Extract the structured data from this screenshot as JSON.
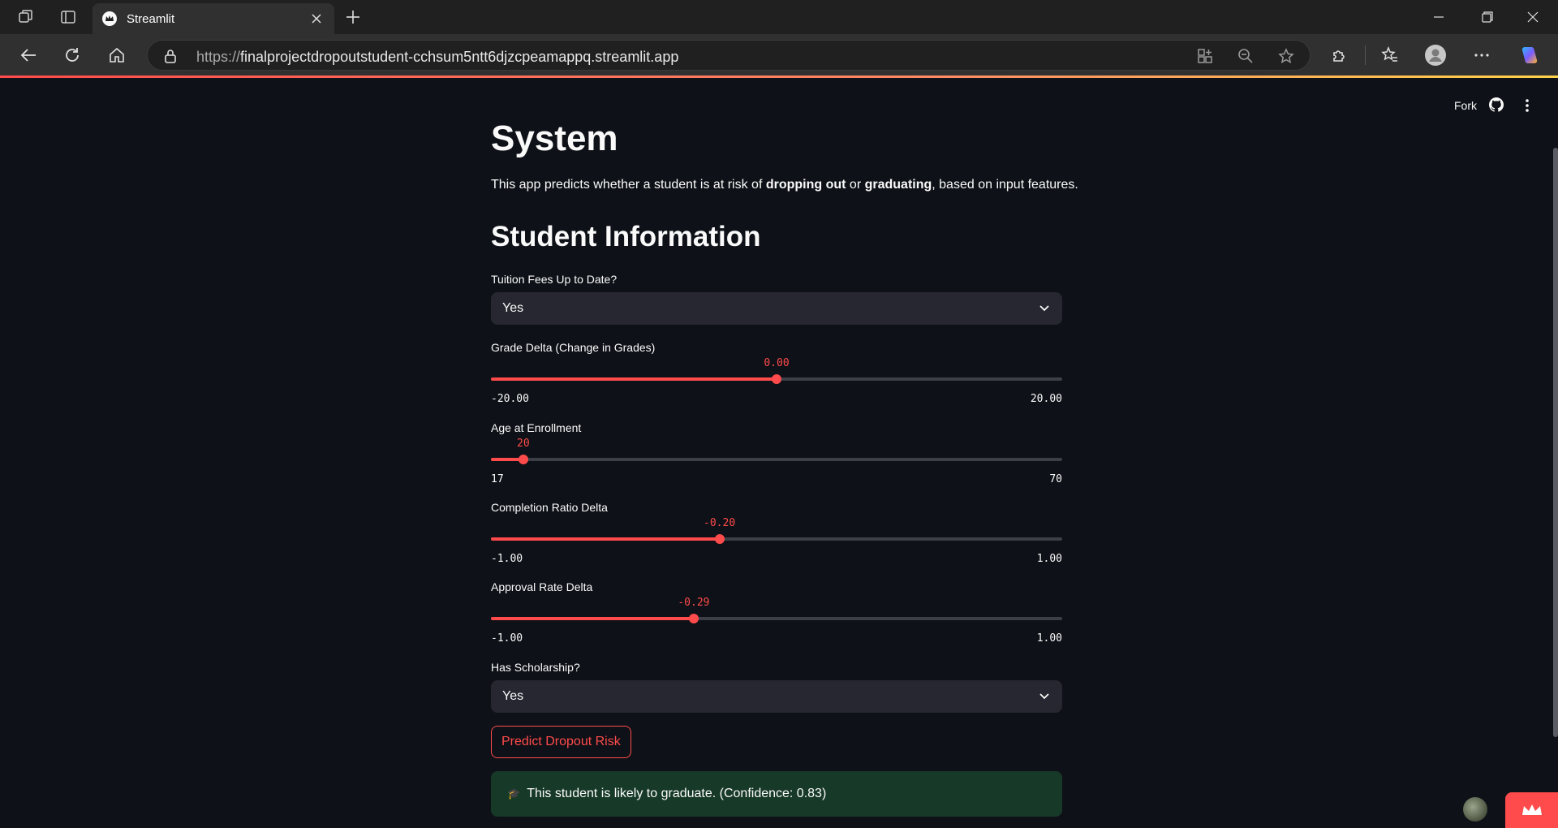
{
  "browser": {
    "tab_title": "Streamlit",
    "url_scheme": "https://",
    "url_host": "finalprojectdropoutstudent-cchsum5ntt6djzcpeamappq.streamlit.app"
  },
  "header": {
    "fork_label": "Fork"
  },
  "page": {
    "title": "System",
    "intro_pre": "This app predicts whether a student is at risk of ",
    "intro_bold1": "dropping out",
    "intro_mid": " or ",
    "intro_bold2": "graduating",
    "intro_post": ", based on input features.",
    "section_title": "Student Information"
  },
  "form": {
    "tuition": {
      "label": "Tuition Fees Up to Date?",
      "value": "Yes"
    },
    "grade_delta": {
      "label": "Grade Delta (Change in Grades)",
      "value": 0.0,
      "value_text": "0.00",
      "min": -20.0,
      "max": 20.0,
      "min_text": "-20.00",
      "max_text": "20.00"
    },
    "age": {
      "label": "Age at Enrollment",
      "value": 20,
      "value_text": "20",
      "min": 17,
      "max": 70,
      "min_text": "17",
      "max_text": "70"
    },
    "completion": {
      "label": "Completion Ratio Delta",
      "value": -0.2,
      "value_text": "-0.20",
      "min": -1.0,
      "max": 1.0,
      "min_text": "-1.00",
      "max_text": "1.00"
    },
    "approval": {
      "label": "Approval Rate Delta",
      "value": -0.29,
      "value_text": "-0.29",
      "min": -1.0,
      "max": 1.0,
      "min_text": "-1.00",
      "max_text": "1.00"
    },
    "scholarship": {
      "label": "Has Scholarship?",
      "value": "Yes"
    },
    "predict_label": "Predict Dropout Risk"
  },
  "result": {
    "emoji": "🎓",
    "text": "This student is likely to graduate. (Confidence: 0.83)"
  },
  "colors": {
    "accent": "#ff4b4b",
    "background": "#0e1117",
    "success_bg": "#173928",
    "widget_bg": "#262730"
  }
}
